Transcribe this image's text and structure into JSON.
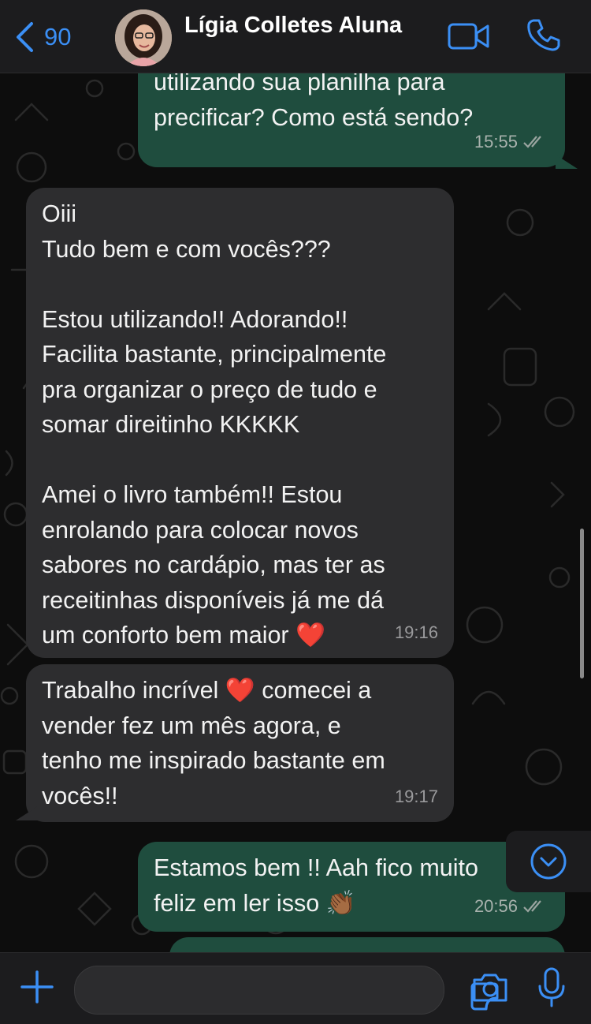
{
  "header": {
    "back_count": "90",
    "contact_name": "Lígia Colletes Aluna"
  },
  "messages": [
    {
      "direction": "outgoing",
      "text": "utilizando sua planilha para\nprecificar? Como está sendo?",
      "time": "15:55",
      "status": "read"
    },
    {
      "direction": "incoming",
      "text": "Oiii\nTudo bem e com vocês???\n\nEstou utilizando!! Adorando!!\nFacilita bastante, principalmente\npra organizar o preço de tudo e\nsomar direitinho KKKKK\n\nAmei o livro também!! Estou\nenrolando para colocar novos\nsabores no cardápio, mas ter as\nreceitinhas disponíveis já me dá\num conforto bem maior ❤️",
      "time": "19:16"
    },
    {
      "direction": "incoming",
      "text": "Trabalho incrível ❤️ comecei a\nvender fez um mês agora, e\ntenho me inspirado bastante em\nvocês!!",
      "time": "19:17"
    },
    {
      "direction": "outgoing",
      "text": "Estamos bem !! Aah fico muito\nfeliz em ler isso 👏🏾",
      "time": "20:56",
      "status": "read"
    }
  ],
  "composer": {
    "placeholder": ""
  },
  "colors": {
    "accent": "#3b8ff5",
    "outgoing_bubble": "#1f4d3e",
    "incoming_bubble": "#2d2d2f",
    "background": "#0d0d0d"
  },
  "icons": {
    "back": "chevron-left-icon",
    "video": "video-camera-icon",
    "call": "phone-icon",
    "scroll_down": "chevron-down-circle-icon",
    "attach": "plus-icon",
    "sticker": "sticker-icon",
    "camera": "camera-icon",
    "mic": "microphone-icon"
  }
}
